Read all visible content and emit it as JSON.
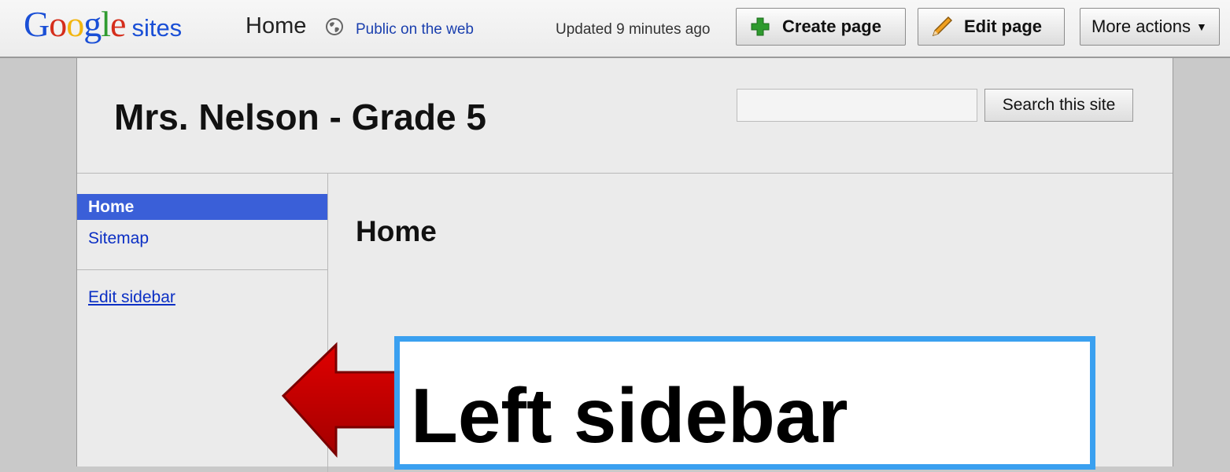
{
  "topbar": {
    "logo_google": [
      "G",
      "o",
      "o",
      "g",
      "l",
      "e"
    ],
    "logo_sites": "sites",
    "page_name": "Home",
    "visibility": "Public on the web",
    "updated": "Updated 9 minutes ago",
    "create_page": "Create page",
    "edit_page": "Edit page",
    "more_actions": "More actions"
  },
  "header": {
    "site_title": "Mrs. Nelson - Grade 5",
    "search_button": "Search this site",
    "search_value": ""
  },
  "sidebar": {
    "items": [
      {
        "label": "Home",
        "selected": true
      },
      {
        "label": "Sitemap",
        "selected": false
      }
    ],
    "edit_sidebar": "Edit sidebar"
  },
  "main": {
    "heading": "Home"
  },
  "callout": {
    "text": "Left sidebar"
  },
  "colors": {
    "selected_nav": "#3a5fd8",
    "link": "#0b2fc4",
    "callout_border": "#3aa0f0",
    "arrow": "#cc0000"
  },
  "icons": [
    "globe-icon",
    "plus-icon",
    "pencil-icon",
    "caret-down-icon",
    "left-arrow-icon"
  ]
}
